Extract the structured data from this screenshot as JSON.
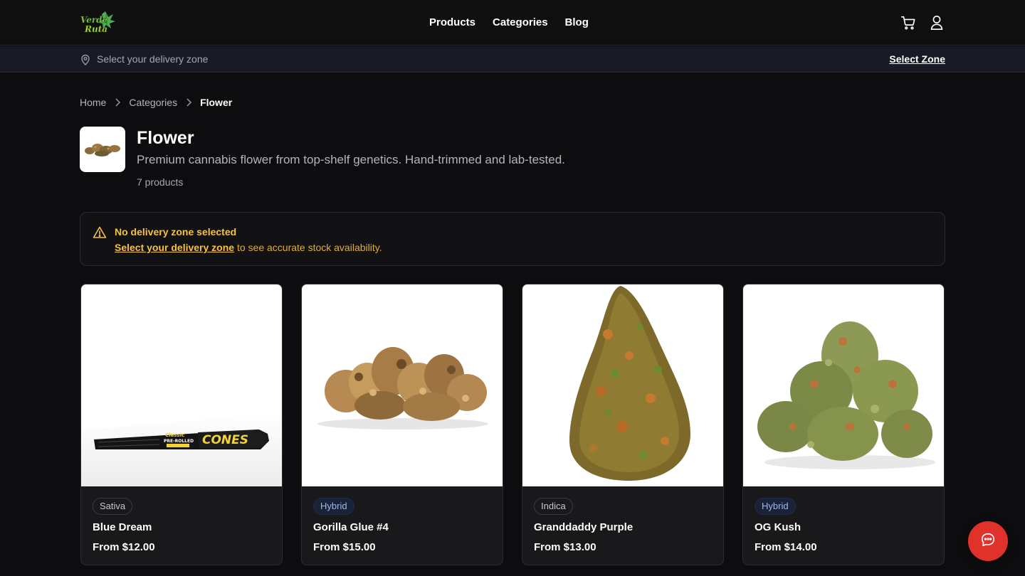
{
  "header": {
    "logo_text": "Verde Ruta",
    "nav": [
      "Products",
      "Categories",
      "Blog"
    ],
    "icons": [
      "cart-icon",
      "user-icon"
    ]
  },
  "zone_bar": {
    "prompt": "Select your delivery zone",
    "action": "Select Zone",
    "icon": "location-pin-icon"
  },
  "breadcrumb": [
    "Home",
    "Categories",
    "Flower"
  ],
  "category": {
    "title": "Flower",
    "description": "Premium cannabis flower from top-shelf genetics. Hand-trimmed and lab-tested.",
    "count": "7 products"
  },
  "alert": {
    "title": "No delivery zone selected",
    "link_text": "Select your delivery zone",
    "body_rest": " to see accurate stock availability.",
    "icon": "warning-triangle-icon",
    "color": "#f5c242"
  },
  "products": [
    {
      "type": "Sativa",
      "name": "Blue Dream",
      "price": "From $12.00"
    },
    {
      "type": "Hybrid",
      "name": "Gorilla Glue #4",
      "price": "From $15.00"
    },
    {
      "type": "Indica",
      "name": "Granddaddy Purple",
      "price": "From $13.00"
    },
    {
      "type": "Hybrid",
      "name": "OG Kush",
      "price": "From $14.00"
    }
  ],
  "product_image_labels": {
    "cone_brand": "CONES",
    "cone_text1": "Classic",
    "cone_text2": "PRE-ROLLED"
  },
  "chat_button": {
    "icon": "chat-bubble-icon",
    "color": "#e0312a"
  }
}
